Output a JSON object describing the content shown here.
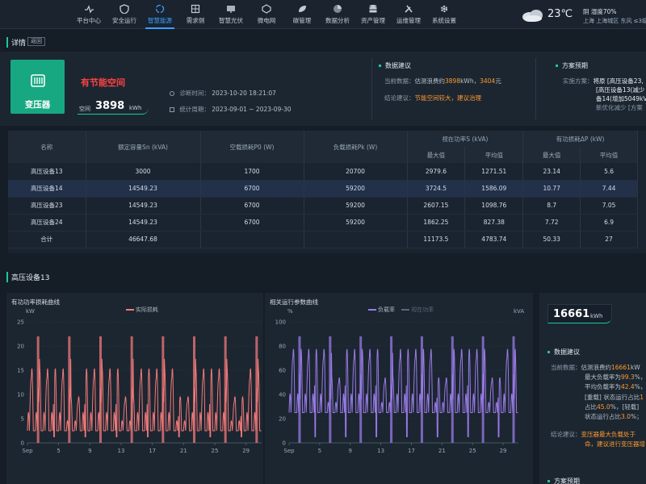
{
  "nav": {
    "items": [
      {
        "label": "平台中心",
        "icon": "heart-monitor-icon"
      },
      {
        "label": "安全运行",
        "icon": "shield-icon"
      },
      {
        "label": "智慧能源",
        "icon": "recycle-icon"
      },
      {
        "label": "需求侧",
        "icon": "grid-icon"
      },
      {
        "label": "智慧光伏",
        "icon": "solar-panel-icon"
      },
      {
        "label": "微电网",
        "icon": "microgrid-icon"
      },
      {
        "label": "碳管理",
        "icon": "leaf-icon"
      },
      {
        "label": "数据分析",
        "icon": "pie-chart-icon"
      },
      {
        "label": "资产管理",
        "icon": "database-icon"
      },
      {
        "label": "运维管理",
        "icon": "tools-icon"
      },
      {
        "label": "系统设置",
        "icon": "gear-icon"
      }
    ],
    "active": "智慧能源"
  },
  "weather": {
    "temp": "23℃",
    "line1": "阴 湿度70%",
    "line2": "上海 上海城区 东风 ≤3级",
    "icon": "cloud-icon"
  },
  "header": {
    "title": "详情",
    "back_label": "返回"
  },
  "device": {
    "label": "变压器",
    "icon": "transformer-icon",
    "tag": "有节能空间",
    "space_label": "空间",
    "space_value": "3898",
    "space_unit": "kWh",
    "diag_time_label": "诊断时间：",
    "diag_time": "2023-10-20 18:21:07",
    "period_label": "统计周期：",
    "period": "2023-09-01 ~ 2023-09-30"
  },
  "data_advice": {
    "title": "数据建议",
    "current_label": "当前数据：",
    "current_pre": "估测浪费约",
    "current_kwh": "3898",
    "current_mid": "kWh，",
    "current_yuan": "3404",
    "current_post": "元",
    "conclusion_label": "结论建议：",
    "conclusion": "节能空间较大，建议治理"
  },
  "plan": {
    "title": "方案预期",
    "label": "实施方案：",
    "line1": "将原 [高压设备23,",
    "line2": "[高压设备13(减少",
    "line3": "备14(增加5049kV",
    "line4": "新优化减少 [方案"
  },
  "table": {
    "headers": {
      "name": "名称",
      "rated": "额定容量Sn (kVA)",
      "noload": "空载损耗P0 (W)",
      "load": "负载损耗Pk (W)",
      "apparent": "视在功率S (kVA)",
      "active_loss": "有功损耗ΔP (kW)",
      "max": "最大值",
      "avg": "平均值"
    },
    "rows": [
      {
        "name": "高压设备13",
        "rated": "3000",
        "p0": "1700",
        "pk": "20700",
        "smax": "2979.6",
        "savg": "1271.51",
        "pmax": "23.14",
        "pavg": "5.6"
      },
      {
        "name": "高压设备14",
        "rated": "14549.23",
        "p0": "6700",
        "pk": "59200",
        "smax": "3724.5",
        "savg": "1586.09",
        "pmax": "10.77",
        "pavg": "7.44"
      },
      {
        "name": "高压设备23",
        "rated": "14549.23",
        "p0": "6700",
        "pk": "59200",
        "smax": "2607.15",
        "savg": "1098.76",
        "pmax": "8.7",
        "pavg": "7.05"
      },
      {
        "name": "高压设备24",
        "rated": "14549.23",
        "p0": "6700",
        "pk": "59200",
        "smax": "1862.25",
        "savg": "827.38",
        "pmax": "7.72",
        "pavg": "6.9"
      },
      {
        "name": "合计",
        "rated": "46647.68",
        "p0": "",
        "pk": "",
        "smax": "11173.5",
        "savg": "4783.74",
        "pmax": "50.33",
        "pavg": "27"
      }
    ]
  },
  "section2": {
    "title": "高压设备13"
  },
  "chart_data": [
    {
      "type": "line",
      "title": "有功功率损耗曲线",
      "ylabel": "kW",
      "ylim": [
        0,
        25
      ],
      "yticks": [
        "0",
        "5",
        "10",
        "15",
        "20",
        "25"
      ],
      "xticks": [
        "Sep",
        "5",
        "9",
        "13",
        "17",
        "21",
        "25",
        "29"
      ],
      "series": [
        {
          "name": "实际损耗",
          "color": "#f07a7a"
        }
      ]
    },
    {
      "type": "line",
      "title": "相关运行参数曲线",
      "ylabel_left": "%",
      "ylabel_right": "kVA",
      "ylim": [
        0,
        100
      ],
      "yticks": [
        "0",
        "20",
        "40",
        "60",
        "80",
        "100"
      ],
      "xticks": [
        "Sep",
        "5",
        "9",
        "13",
        "17",
        "21",
        "25",
        "29"
      ],
      "series": [
        {
          "name": "负载率",
          "color": "#9a7be6"
        },
        {
          "name": "视在功率",
          "color": "#5b6676"
        }
      ]
    }
  ],
  "right": {
    "big_value": "16661",
    "big_unit": "kWh",
    "title": "数据建议",
    "current_label": "当前数据：",
    "l1_pre": "估测浪费约",
    "l1_val": "16661",
    "l1_post": "kW",
    "l2_pre": "最大负载率为",
    "l2_val": "99.3",
    "l2_post": "%，",
    "l3_pre": "平均负载率为",
    "l3_val": "42.4",
    "l3_post": "%，",
    "l4_pre": "[重载] 状态运行占比",
    "l4_val": "1",
    "l5_pre": "占比",
    "l5_val": "45.0",
    "l5_post": "%，[轻载]",
    "l6_pre": "状态运行占比",
    "l6_val": "3.0",
    "l6_post": "%；",
    "conclusion_label": "结论建议：",
    "c1": "变压器最大负载处于",
    "c2": "命，建议进行变压器增",
    "next_title": "方案预期"
  }
}
